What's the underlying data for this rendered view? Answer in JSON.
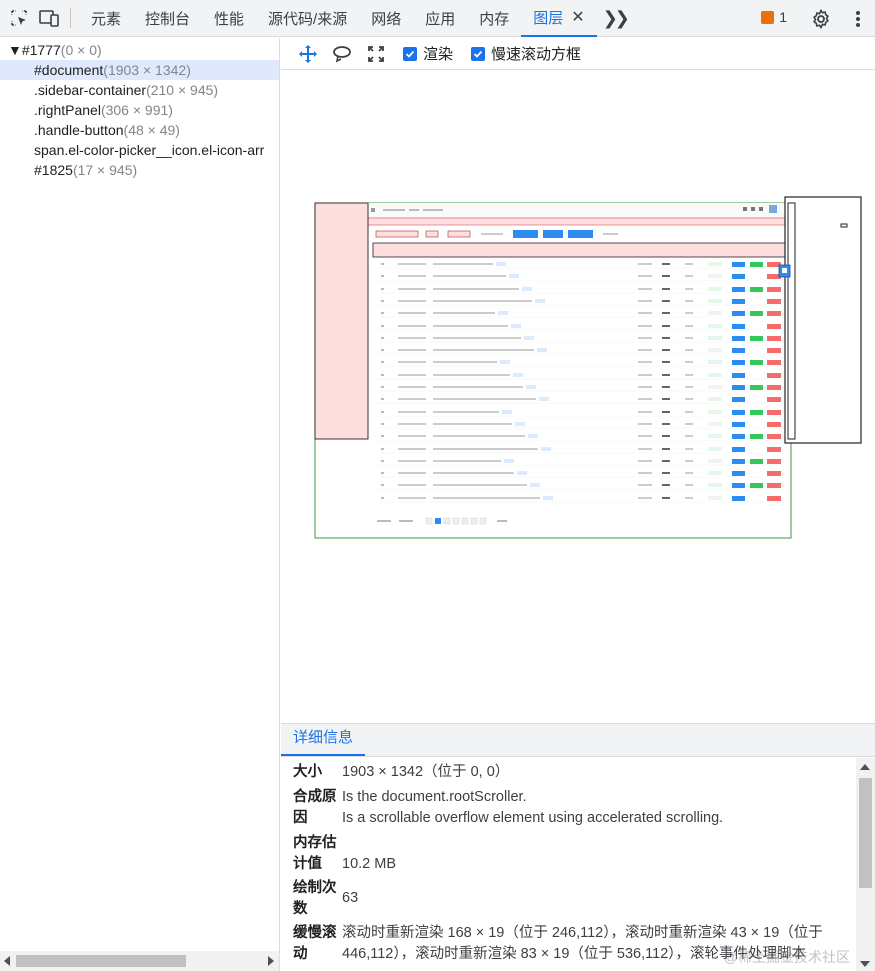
{
  "tabs": [
    {
      "label": "元素"
    },
    {
      "label": "控制台"
    },
    {
      "label": "性能"
    },
    {
      "label": "源代码/来源"
    },
    {
      "label": "网络"
    },
    {
      "label": "应用"
    },
    {
      "label": "内存"
    },
    {
      "label": "图层",
      "active": true
    }
  ],
  "issues_count": "1",
  "tree": [
    {
      "name": "▼#1777",
      "dim": "(0 × 0)"
    },
    {
      "name": "#document",
      "dim": "(1903 × 1342)"
    },
    {
      "name": ".sidebar-container",
      "dim": "(210 × 945)"
    },
    {
      "name": ".rightPanel",
      "dim": "(306 × 991)"
    },
    {
      "name": ".handle-button",
      "dim": "(48 × 49)"
    },
    {
      "name": "span.el-color-picker__icon.el-icon-arr",
      "dim": ""
    },
    {
      "name": "#1825",
      "dim": "(17 × 945)"
    }
  ],
  "toolbar": {
    "paint_label": "渲染",
    "scroll_label": "慢速滚动方框"
  },
  "details": {
    "tab": "详细信息",
    "rows": [
      {
        "key": "大小",
        "value": "1903 × 1342（位于 0, 0）"
      },
      {
        "key": "合成原因",
        "value": "Is the document.rootScroller.\nIs a scrollable overflow element using accelerated scrolling."
      },
      {
        "key": "内存估计值",
        "value": "10.2 MB"
      },
      {
        "key": "绘制次数",
        "value": "63"
      },
      {
        "key": "缓慢滚动",
        "value": "滚动时重新渲染 168 × 19（位于 246,112），滚动时重新渲染 43 × 19（位于 446,112），滚动时重新渲染 83 × 19（位于 536,112），滚轮事件处理脚本"
      }
    ]
  },
  "watermark": "@稀土掘金技术社区",
  "colors": {
    "accent": "#1a73e8",
    "selection": "#e0e9fc",
    "layer_pink": "#ffdede",
    "layer_green": "#3a9a4a"
  }
}
